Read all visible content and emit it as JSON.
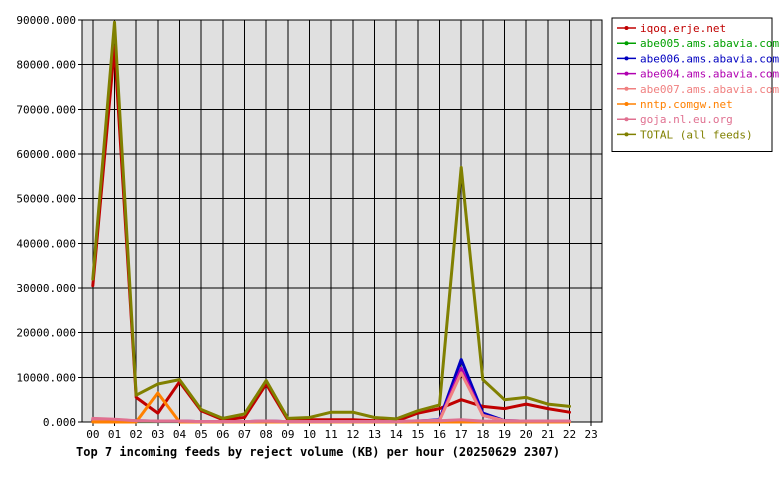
{
  "chart_data": {
    "type": "line",
    "title": "Top 7 incoming feeds by reject volume (KB) per hour (20250629 2307)",
    "xlabel": "",
    "ylabel": "",
    "ylim": [
      0,
      90000
    ],
    "yticks": [
      "0.000",
      "10000.000",
      "20000.000",
      "30000.000",
      "40000.000",
      "50000.000",
      "60000.000",
      "70000.000",
      "80000.000",
      "90000.000"
    ],
    "categories": [
      "00",
      "01",
      "02",
      "03",
      "04",
      "05",
      "06",
      "07",
      "08",
      "09",
      "10",
      "11",
      "12",
      "13",
      "14",
      "15",
      "16",
      "17",
      "18",
      "19",
      "20",
      "21",
      "22",
      "23"
    ],
    "grid": true,
    "legend_position": "right",
    "series": [
      {
        "name": "iqoq.erje.net",
        "color": "#c00000",
        "values": [
          30500,
          84000,
          5500,
          2000,
          9000,
          2500,
          500,
          1000,
          8500,
          500,
          500,
          500,
          500,
          300,
          200,
          2000,
          3000,
          5000,
          3500,
          3000,
          4000,
          3000,
          2200,
          null
        ]
      },
      {
        "name": "abe005.ams.abavia.com",
        "color": "#00a000",
        "values": [
          300,
          200,
          100,
          100,
          100,
          50,
          50,
          50,
          100,
          50,
          50,
          50,
          50,
          50,
          50,
          50,
          100,
          200,
          100,
          100,
          100,
          100,
          100,
          null
        ]
      },
      {
        "name": "abe006.ams.abavia.com",
        "color": "#0000c0",
        "values": [
          500,
          400,
          300,
          200,
          200,
          100,
          100,
          100,
          200,
          100,
          100,
          100,
          100,
          100,
          100,
          200,
          500,
          14000,
          2000,
          300,
          200,
          200,
          200,
          null
        ]
      },
      {
        "name": "abe004.ams.abavia.com",
        "color": "#b000b0",
        "values": [
          300,
          300,
          200,
          200,
          200,
          100,
          100,
          100,
          200,
          100,
          100,
          100,
          100,
          100,
          100,
          200,
          400,
          12000,
          1500,
          300,
          200,
          200,
          200,
          null
        ]
      },
      {
        "name": "abe007.ams.abavia.com",
        "color": "#f08080",
        "values": [
          600,
          500,
          300,
          200,
          200,
          100,
          100,
          100,
          200,
          100,
          100,
          100,
          100,
          100,
          100,
          200,
          400,
          11000,
          1500,
          300,
          200,
          200,
          200,
          null
        ]
      },
      {
        "name": "nntp.comgw.net",
        "color": "#ff8000",
        "values": [
          0,
          0,
          0,
          6500,
          0,
          0,
          0,
          0,
          0,
          0,
          0,
          0,
          0,
          0,
          0,
          0,
          0,
          0,
          0,
          0,
          0,
          0,
          0,
          null
        ]
      },
      {
        "name": "goja.nl.eu.org",
        "color": "#e07090",
        "values": [
          800,
          600,
          300,
          200,
          200,
          100,
          100,
          100,
          200,
          100,
          100,
          100,
          100,
          100,
          100,
          300,
          300,
          500,
          200,
          200,
          200,
          200,
          200,
          null
        ]
      },
      {
        "name": "TOTAL (all feeds)",
        "color": "#808000",
        "values": [
          32000,
          89500,
          6000,
          8500,
          9500,
          2800,
          800,
          1800,
          9300,
          800,
          1000,
          2200,
          2200,
          1000,
          700,
          2500,
          3800,
          57000,
          9500,
          5000,
          5500,
          4000,
          3500,
          null
        ]
      }
    ]
  }
}
